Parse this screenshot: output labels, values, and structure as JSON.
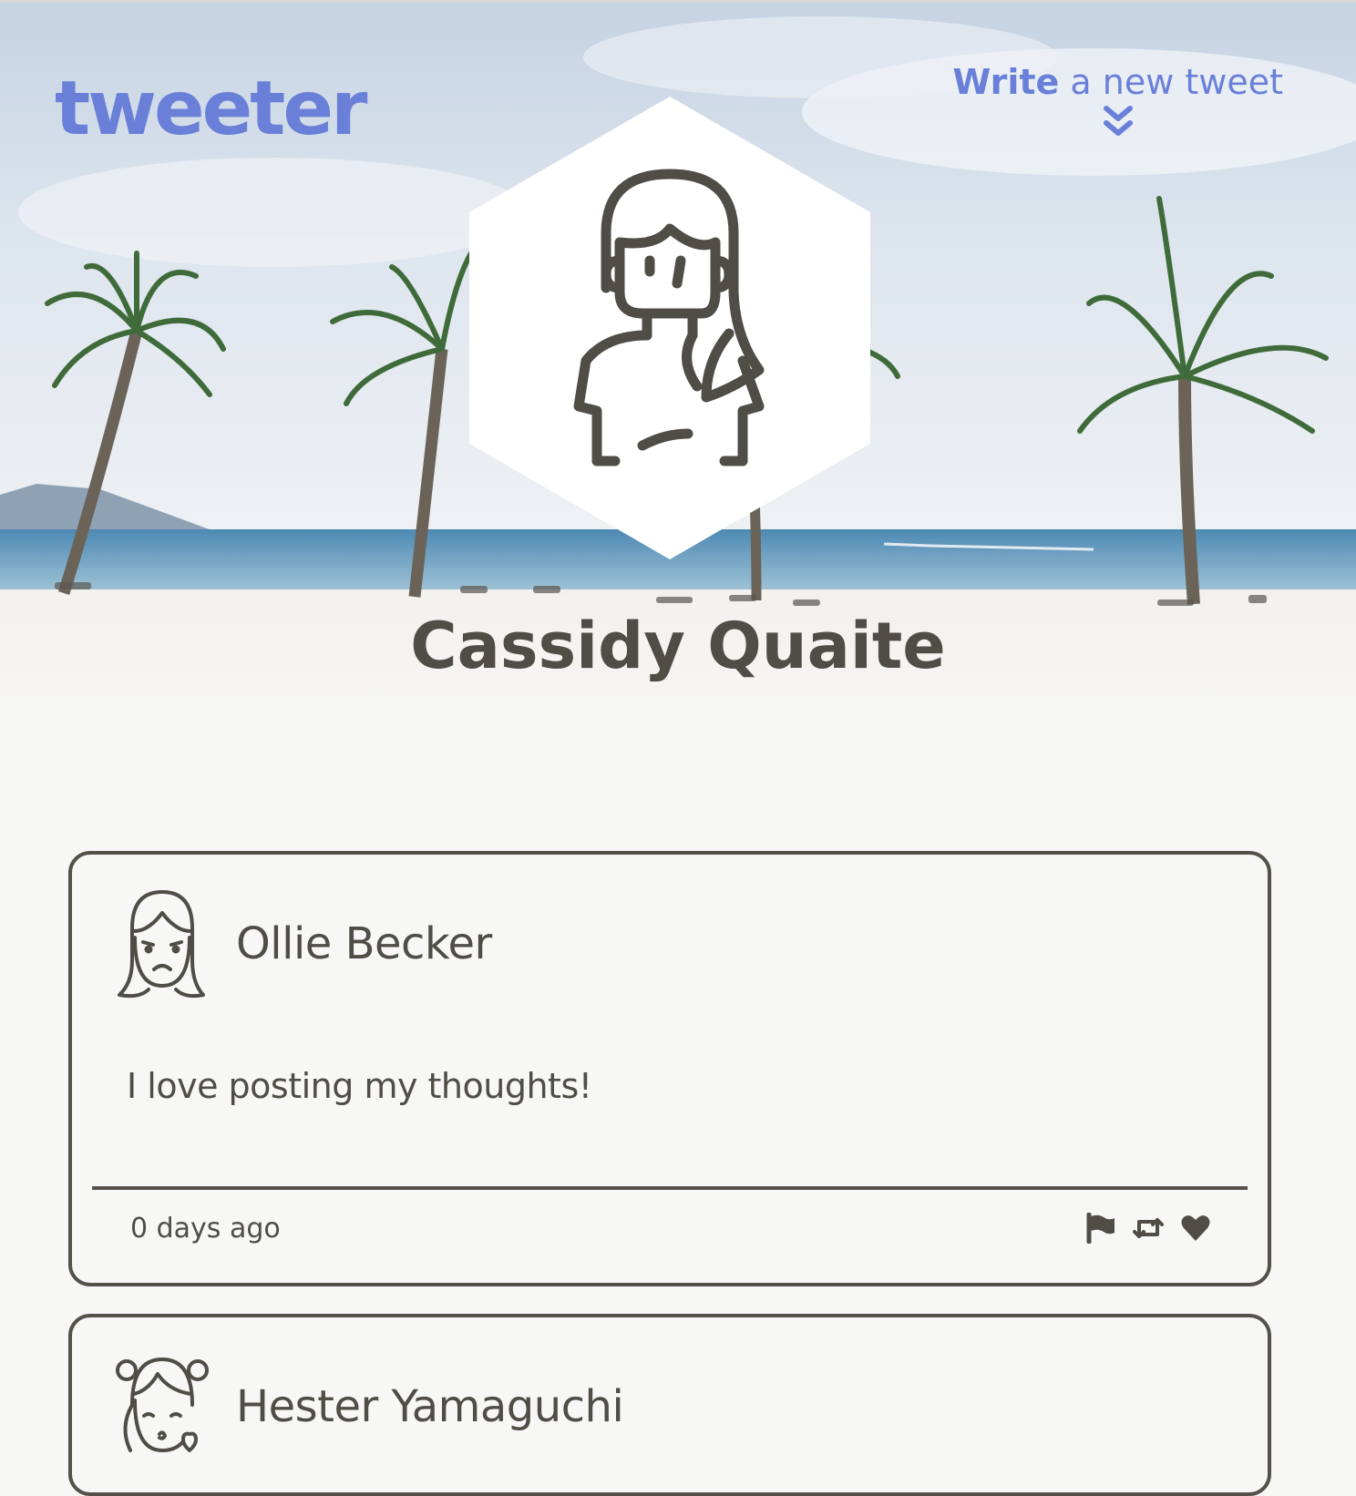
{
  "header": {
    "brand": "tweeter",
    "compose_strong": "Write",
    "compose_rest": " a new tweet",
    "compose_icon": "double-chevron-down-icon"
  },
  "profile": {
    "name": "Cassidy Quaite",
    "avatar_icon": "woman-avatar-icon"
  },
  "colors": {
    "accent": "#6a80d8",
    "text": "#545149",
    "background": "#f7f7f5"
  },
  "tweets": [
    {
      "author": "Ollie Becker",
      "avatar_icon": "sad-girl-avatar-icon",
      "text": "I love posting my thoughts!",
      "time": "0 days ago",
      "actions": [
        "flag-icon",
        "retweet-icon",
        "heart-icon"
      ]
    },
    {
      "author": "Hester Yamaguchi",
      "avatar_icon": "kissing-girl-avatar-icon"
    }
  ]
}
